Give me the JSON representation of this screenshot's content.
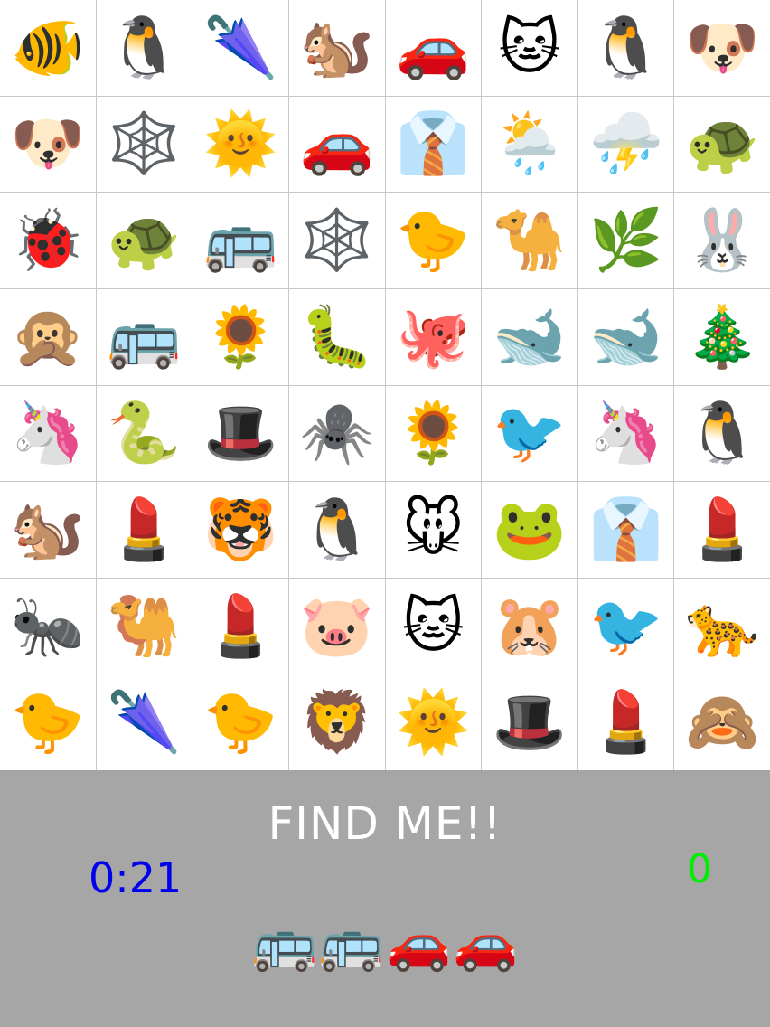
{
  "colors": {
    "panel_background": "#a6a6a6",
    "grid_lines": "#c8c8c8",
    "title_color": "#ffffff",
    "timer_color": "#0000ee",
    "score_color": "#00ee00"
  },
  "grid": [
    {
      "emoji": "🐠",
      "icon": "tropical-fish-icon"
    },
    {
      "emoji": "🐧",
      "icon": "penguin-icon"
    },
    {
      "emoji": "🌂",
      "icon": "closed-umbrella-icon"
    },
    {
      "emoji": "🐿️",
      "icon": "chipmunk-icon"
    },
    {
      "emoji": "🚗",
      "icon": "car-icon"
    },
    {
      "emoji": "🐱",
      "icon": "cat-face-icon"
    },
    {
      "emoji": "🐧",
      "icon": "penguin-icon"
    },
    {
      "emoji": "🐶",
      "icon": "dog-face-icon"
    },
    {
      "emoji": "🐶",
      "icon": "dog-face-icon"
    },
    {
      "emoji": "🕸️",
      "icon": "spider-web-icon"
    },
    {
      "emoji": "🌞",
      "icon": "sun-with-face-icon"
    },
    {
      "emoji": "🚗",
      "icon": "car-icon"
    },
    {
      "emoji": "👔",
      "icon": "necktie-shirt-icon"
    },
    {
      "emoji": "🌦️",
      "icon": "sun-behind-rain-cloud-icon"
    },
    {
      "emoji": "⛈️",
      "icon": "thunder-cloud-rain-icon"
    },
    {
      "emoji": "🐢",
      "icon": "turtle-icon"
    },
    {
      "emoji": "🐞",
      "icon": "ladybug-icon"
    },
    {
      "emoji": "🐢",
      "icon": "turtle-icon"
    },
    {
      "emoji": "🚌",
      "icon": "bus-icon"
    },
    {
      "emoji": "🕸️",
      "icon": "spider-web-icon"
    },
    {
      "emoji": "🐤",
      "icon": "baby-chick-icon"
    },
    {
      "emoji": "🐪",
      "icon": "camel-icon"
    },
    {
      "emoji": "🌿",
      "icon": "herb-icon"
    },
    {
      "emoji": "🐰",
      "icon": "rabbit-face-icon"
    },
    {
      "emoji": "🙊",
      "icon": "speak-no-evil-monkey-icon"
    },
    {
      "emoji": "🚌",
      "icon": "bus-icon"
    },
    {
      "emoji": "🌻",
      "icon": "sunflower-icon"
    },
    {
      "emoji": "🐛",
      "icon": "caterpillar-icon"
    },
    {
      "emoji": "🐙",
      "icon": "octopus-icon"
    },
    {
      "emoji": "🐋",
      "icon": "whale-icon"
    },
    {
      "emoji": "🐋",
      "icon": "whale-icon"
    },
    {
      "emoji": "🎄",
      "icon": "christmas-tree-icon"
    },
    {
      "emoji": "🦄",
      "icon": "unicorn-icon"
    },
    {
      "emoji": "🐍",
      "icon": "snake-icon"
    },
    {
      "emoji": "🎩",
      "icon": "top-hat-icon"
    },
    {
      "emoji": "🕷️",
      "icon": "spider-icon"
    },
    {
      "emoji": "🌻",
      "icon": "sunflower-icon"
    },
    {
      "emoji": "🐦",
      "icon": "bird-icon"
    },
    {
      "emoji": "🦄",
      "icon": "unicorn-icon"
    },
    {
      "emoji": "🐧",
      "icon": "penguin-icon"
    },
    {
      "emoji": "🐿️",
      "icon": "chipmunk-icon"
    },
    {
      "emoji": "💄",
      "icon": "lipstick-icon"
    },
    {
      "emoji": "🐯",
      "icon": "tiger-face-icon"
    },
    {
      "emoji": "🐧",
      "icon": "penguin-icon"
    },
    {
      "emoji": "🐭",
      "icon": "mouse-face-icon"
    },
    {
      "emoji": "🐸",
      "icon": "frog-face-icon"
    },
    {
      "emoji": "👔",
      "icon": "necktie-shirt-icon"
    },
    {
      "emoji": "💄",
      "icon": "lipstick-icon"
    },
    {
      "emoji": "🐜",
      "icon": "ant-icon"
    },
    {
      "emoji": "🐫",
      "icon": "camel-icon"
    },
    {
      "emoji": "💄",
      "icon": "lipstick-icon"
    },
    {
      "emoji": "🐷",
      "icon": "pig-face-icon"
    },
    {
      "emoji": "🐱",
      "icon": "cat-face-icon"
    },
    {
      "emoji": "🐹",
      "icon": "hamster-face-icon"
    },
    {
      "emoji": "🐦",
      "icon": "bird-icon"
    },
    {
      "emoji": "🐆",
      "icon": "leopard-icon"
    },
    {
      "emoji": "🐤",
      "icon": "baby-chick-icon"
    },
    {
      "emoji": "🌂",
      "icon": "closed-umbrella-icon"
    },
    {
      "emoji": "🐤",
      "icon": "baby-chick-icon"
    },
    {
      "emoji": "🦁",
      "icon": "lion-face-icon"
    },
    {
      "emoji": "🌞",
      "icon": "sun-with-face-icon"
    },
    {
      "emoji": "🎩",
      "icon": "top-hat-icon"
    },
    {
      "emoji": "💄",
      "icon": "lipstick-icon"
    },
    {
      "emoji": "🙈",
      "icon": "see-no-evil-monkey-icon"
    }
  ],
  "panel": {
    "title": "FIND ME!!",
    "timer": "0:21",
    "score": "0",
    "targets": [
      {
        "emoji": "🚌",
        "icon": "bus-icon"
      },
      {
        "emoji": "🚌",
        "icon": "bus-icon"
      },
      {
        "emoji": "🚗",
        "icon": "car-icon"
      },
      {
        "emoji": "🚗",
        "icon": "car-icon"
      }
    ]
  }
}
